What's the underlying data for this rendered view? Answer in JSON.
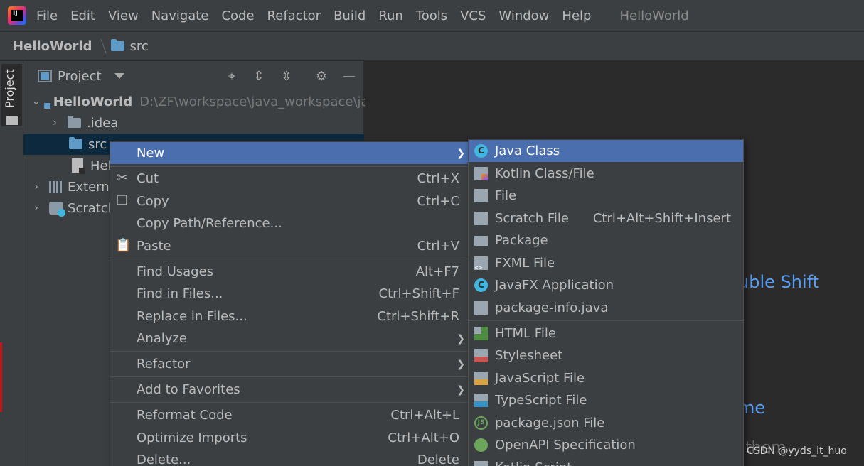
{
  "menubar": {
    "items": [
      "File",
      "Edit",
      "View",
      "Navigate",
      "Code",
      "Refactor",
      "Build",
      "Run",
      "Tools",
      "VCS",
      "Window",
      "Help"
    ],
    "window_title": "HelloWorld"
  },
  "breadcrumb": {
    "project": "HelloWorld",
    "folder": "src"
  },
  "tool_strip": {
    "project_label": "Project"
  },
  "project_panel": {
    "title": "Project",
    "tree": [
      {
        "label": "HelloWorld",
        "path": "D:\\ZF\\workspace\\java_workspace\\ja",
        "expanded": true
      },
      {
        "label": ".idea",
        "expanded": false
      },
      {
        "label": "src",
        "selected": true
      },
      {
        "label": "Hel"
      },
      {
        "label": "Externa"
      },
      {
        "label": "Scratch"
      }
    ]
  },
  "context_menu": {
    "items": [
      {
        "label": "New",
        "shortcut": "",
        "submenu": true,
        "highlight": true
      },
      {
        "label": "Cut",
        "shortcut": "Ctrl+X",
        "icon": "scissors-icon"
      },
      {
        "label": "Copy",
        "shortcut": "Ctrl+C",
        "icon": "copy-icon"
      },
      {
        "label": "Copy Path/Reference...",
        "shortcut": ""
      },
      {
        "label": "Paste",
        "shortcut": "Ctrl+V",
        "icon": "clipboard-icon"
      },
      {
        "label": "Find Usages",
        "shortcut": "Alt+F7"
      },
      {
        "label": "Find in Files...",
        "shortcut": "Ctrl+Shift+F"
      },
      {
        "label": "Replace in Files...",
        "shortcut": "Ctrl+Shift+R"
      },
      {
        "label": "Analyze",
        "shortcut": "",
        "submenu": true
      },
      {
        "label": "Refactor",
        "shortcut": "",
        "submenu": true
      },
      {
        "label": "Add to Favorites",
        "shortcut": "",
        "submenu": true
      },
      {
        "label": "Reformat Code",
        "shortcut": "Ctrl+Alt+L"
      },
      {
        "label": "Optimize Imports",
        "shortcut": "Ctrl+Alt+O"
      },
      {
        "label": "Delete...",
        "shortcut": "Delete"
      }
    ]
  },
  "new_submenu": {
    "items": [
      {
        "label": "Java Class",
        "shortcut": "",
        "highlight": true
      },
      {
        "label": "Kotlin Class/File",
        "shortcut": ""
      },
      {
        "label": "File",
        "shortcut": ""
      },
      {
        "label": "Scratch File",
        "shortcut": "Ctrl+Alt+Shift+Insert"
      },
      {
        "label": "Package",
        "shortcut": ""
      },
      {
        "label": "FXML File",
        "shortcut": ""
      },
      {
        "label": "JavaFX Application",
        "shortcut": ""
      },
      {
        "label": "package-info.java",
        "shortcut": ""
      },
      {
        "label": "HTML File",
        "shortcut": ""
      },
      {
        "label": "Stylesheet",
        "shortcut": ""
      },
      {
        "label": "JavaScript File",
        "shortcut": ""
      },
      {
        "label": "TypeScript File",
        "shortcut": ""
      },
      {
        "label": "package.json File",
        "shortcut": ""
      },
      {
        "label": "OpenAPI Specification",
        "shortcut": ""
      },
      {
        "label": "Kotlin Script",
        "shortcut": ""
      }
    ]
  },
  "editor": {
    "hint_shift": "uble Shift",
    "hint_recent": "me",
    "hint_them": "them"
  },
  "watermark": "CSDN @yyds_it_huo",
  "colors": {
    "highlight": "#4b6eaf",
    "panel": "#3c3f41",
    "editor": "#2b2b2b",
    "link": "#589df6"
  }
}
